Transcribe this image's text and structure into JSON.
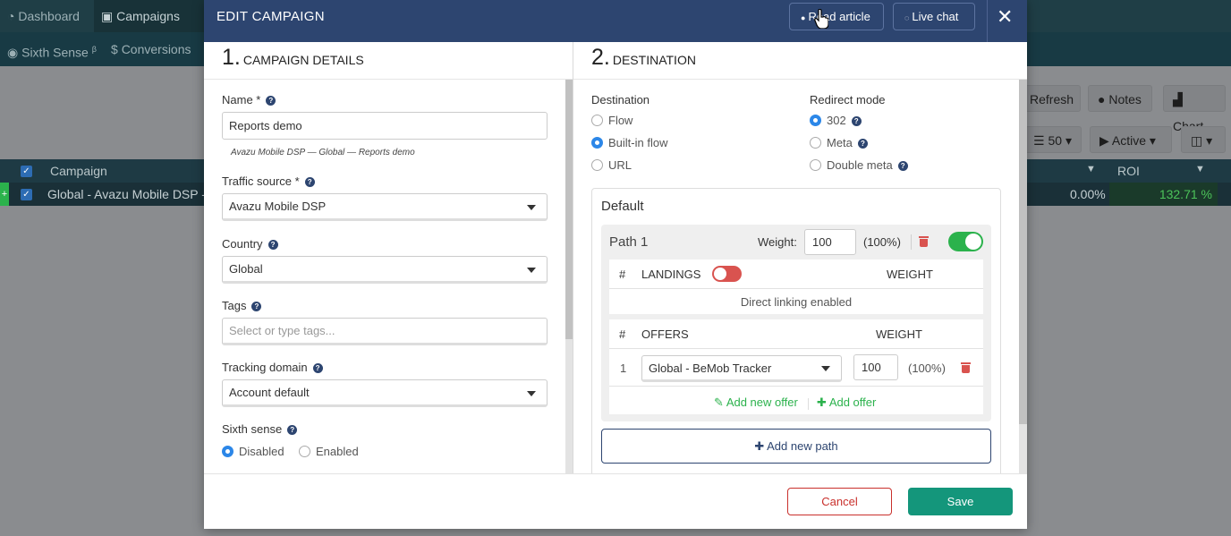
{
  "app": {
    "topnav": [
      {
        "label": "Dashboard",
        "icon": "dashboard-icon"
      },
      {
        "label": "Campaigns",
        "icon": "briefcase-icon",
        "active": true
      }
    ],
    "subnav": [
      {
        "label": "Sixth Sense",
        "sup": "β",
        "icon": "eye-icon"
      },
      {
        "label": "Conversions",
        "icon": "dollar-icon"
      }
    ],
    "toolbar": {
      "refresh": "Refresh",
      "notes": "Notes",
      "chart": "Chart",
      "page_size": "50",
      "status": "Active"
    },
    "table": {
      "columns": [
        "Campaign",
        "ROI"
      ],
      "row": {
        "name": "Global - Avazu Mobile DSP - Re",
        "value1": "0.00%",
        "roi": "132.71 %"
      }
    }
  },
  "modal": {
    "title": "EDIT CAMPAIGN",
    "read_article": "Read article",
    "live_chat": "Live chat",
    "close": "✕",
    "section1": {
      "num": "1.",
      "title": "CAMPAIGN DETAILS"
    },
    "section2": {
      "num": "2.",
      "title": "DESTINATION"
    },
    "name": {
      "label": "Name *",
      "value": "Reports demo",
      "hint": "Avazu Mobile DSP — Global — Reports demo"
    },
    "traffic_source": {
      "label": "Traffic source *",
      "value": "Avazu Mobile DSP"
    },
    "country": {
      "label": "Country",
      "value": "Global"
    },
    "tags": {
      "label": "Tags",
      "placeholder": "Select or type tags..."
    },
    "tracking_domain": {
      "label": "Tracking domain",
      "value": "Account default"
    },
    "sixth_sense": {
      "label": "Sixth sense",
      "options": [
        "Disabled",
        "Enabled"
      ],
      "selected": "Disabled"
    },
    "destination": {
      "label": "Destination",
      "options": [
        "Flow",
        "Built-in flow",
        "URL"
      ],
      "selected": "Built-in flow"
    },
    "redirect": {
      "label": "Redirect mode",
      "options": [
        "302",
        "Meta",
        "Double meta"
      ],
      "selected": "302"
    },
    "default": {
      "title": "Default",
      "path": {
        "name": "Path 1",
        "weight_label": "Weight:",
        "weight": "100",
        "weight_pct": "(100%)",
        "enabled": true,
        "landings": {
          "hash": "#",
          "label": "LANDINGS",
          "weight": "WEIGHT",
          "enabled": false,
          "note": "Direct linking enabled"
        },
        "offers": {
          "hash": "#",
          "label": "OFFERS",
          "weight": "WEIGHT",
          "rows": [
            {
              "index": "1",
              "name": "Global - BeMob Tracker",
              "weight": "100",
              "pct": "(100%)"
            }
          ],
          "add_new_offer": "Add new offer",
          "add_offer": "Add offer"
        }
      },
      "add_new_path": "Add new path"
    },
    "cancel": "Cancel",
    "save": "Save"
  },
  "colors": {
    "header": "#2d4570",
    "accent": "#2c87e8",
    "save": "#14967b",
    "danger": "#d9534f",
    "success": "#2bb24c"
  }
}
